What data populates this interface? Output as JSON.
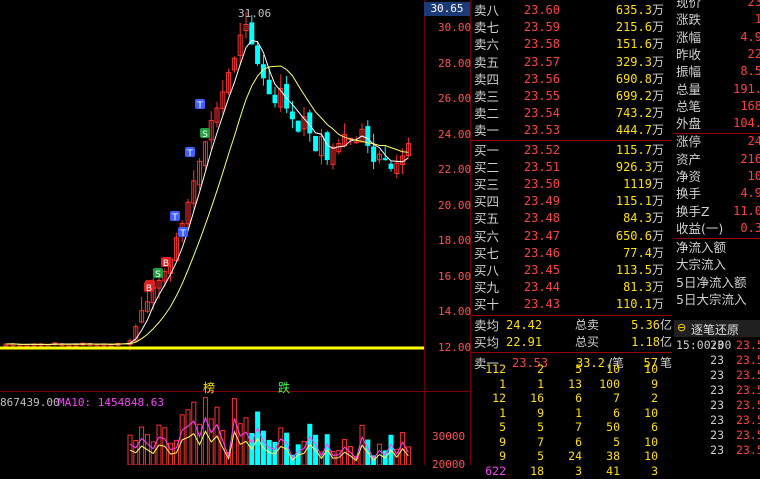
{
  "colors": {
    "up": "#ff3030",
    "down": "#00ffff",
    "ma5": "#ffffff",
    "ma10": "#ffff60",
    "ma20": "#ff40ff",
    "base": "#ffff00"
  },
  "chart": {
    "high_label": "31.06",
    "current_price_tag": "30.65",
    "y_labels": [
      "30.00",
      "28.00",
      "26.00",
      "24.00",
      "22.00",
      "20.00",
      "18.00",
      "16.00",
      "14.00",
      "12.00"
    ],
    "signals": [
      "T",
      "S",
      "B",
      "S",
      "B",
      "T",
      "T",
      "B",
      "T"
    ],
    "markers": {
      "bang": "榜",
      "die": "跌"
    },
    "volume_header": {
      "prefix": "867439.00",
      "ma10": "MA10: 1454848.63"
    },
    "vol_axis": [
      "30000",
      "20000"
    ]
  },
  "chart_data": {
    "type": "candlestick",
    "y_range": [
      12.0,
      31.06
    ],
    "baseline": 12.0
  },
  "order_book": {
    "sell": [
      {
        "label": "卖八",
        "price": "23.60",
        "vol": "635.3",
        "unit": "万"
      },
      {
        "label": "卖七",
        "price": "23.59",
        "vol": "215.6",
        "unit": "万"
      },
      {
        "label": "卖六",
        "price": "23.58",
        "vol": "151.6",
        "unit": "万"
      },
      {
        "label": "卖五",
        "price": "23.57",
        "vol": "329.3",
        "unit": "万"
      },
      {
        "label": "卖四",
        "price": "23.56",
        "vol": "690.8",
        "unit": "万"
      },
      {
        "label": "卖三",
        "price": "23.55",
        "vol": "699.2",
        "unit": "万"
      },
      {
        "label": "卖二",
        "price": "23.54",
        "vol": "743.2",
        "unit": "万"
      },
      {
        "label": "卖一",
        "price": "23.53",
        "vol": "444.7",
        "unit": "万"
      }
    ],
    "buy": [
      {
        "label": "买一",
        "price": "23.52",
        "vol": "115.7",
        "unit": "万"
      },
      {
        "label": "买二",
        "price": "23.51",
        "vol": "926.3",
        "unit": "万"
      },
      {
        "label": "买三",
        "price": "23.50",
        "vol": "1119",
        "unit": "万"
      },
      {
        "label": "买四",
        "price": "23.49",
        "vol": "115.1",
        "unit": "万"
      },
      {
        "label": "买五",
        "price": "23.48",
        "vol": "84.3",
        "unit": "万"
      },
      {
        "label": "买六",
        "price": "23.47",
        "vol": "650.6",
        "unit": "万"
      },
      {
        "label": "买七",
        "price": "23.46",
        "vol": "77.4",
        "unit": "万"
      },
      {
        "label": "买八",
        "price": "23.45",
        "vol": "113.5",
        "unit": "万"
      },
      {
        "label": "买九",
        "price": "23.44",
        "vol": "81.3",
        "unit": "万"
      },
      {
        "label": "买十",
        "price": "23.43",
        "vol": "110.1",
        "unit": "万"
      }
    ],
    "summary": [
      {
        "label": "卖均",
        "price": "24.42",
        "l2": "总卖",
        "v": "5.36",
        "u": "亿"
      },
      {
        "label": "买均",
        "price": "22.91",
        "l2": "总买",
        "v": "1.18",
        "u": "亿"
      }
    ],
    "sell1_row": {
      "label": "卖一",
      "price": "23.53",
      "vol": "33.2",
      "unit": "/笔",
      "count": "57",
      "count_unit": "笔"
    }
  },
  "quote": {
    "rows": [
      {
        "label": "现价",
        "value": "23"
      },
      {
        "label": "涨跌",
        "value": "1"
      },
      {
        "label": "涨幅",
        "value": "4.9"
      },
      {
        "label": "昨收",
        "value": "22"
      },
      {
        "label": "振幅",
        "value": "8.5"
      },
      {
        "label": "总量",
        "value": "191."
      },
      {
        "label": "总笔",
        "value": "168"
      },
      {
        "label": "外盘",
        "value": "104."
      },
      {
        "label": "涨停",
        "value": "24"
      },
      {
        "label": "资产",
        "value": "216"
      },
      {
        "label": "净资",
        "value": "10"
      },
      {
        "label": "换手",
        "value": "4.9"
      },
      {
        "label": "换手Z",
        "value": "11.0"
      },
      {
        "label": "收益(一)",
        "value": "0.3"
      }
    ],
    "flows": [
      "净流入额",
      "大宗流入",
      "5日净流入额",
      "5日大宗流入"
    ],
    "tick_header": "逐笔还原"
  },
  "queue_grid": [
    [
      "112",
      "2",
      "5",
      "10",
      "10"
    ],
    [
      "1",
      "1",
      "13",
      "100",
      "9"
    ],
    [
      "12",
      "16",
      "6",
      "7",
      "2"
    ],
    [
      "1",
      "9",
      "1",
      "6",
      "10"
    ],
    [
      "5",
      "5",
      "7",
      "50",
      "6"
    ],
    [
      "9",
      "7",
      "6",
      "5",
      "10"
    ],
    [
      "9",
      "5",
      "24",
      "38",
      "10"
    ],
    [
      "622",
      "18",
      "3",
      "41",
      "3"
    ]
  ],
  "ticks": [
    {
      "time": "15:00:00",
      "a": "23",
      "b": "23.5"
    },
    {
      "time": "",
      "a": "23",
      "b": "23.5"
    },
    {
      "time": "",
      "a": "23",
      "b": "23.5"
    },
    {
      "time": "",
      "a": "23",
      "b": "23.5"
    },
    {
      "time": "",
      "a": "23",
      "b": "23.5"
    },
    {
      "time": "",
      "a": "23",
      "b": "23.5"
    },
    {
      "time": "",
      "a": "23",
      "b": "23.5"
    },
    {
      "time": "",
      "a": "23",
      "b": "23.5"
    }
  ]
}
